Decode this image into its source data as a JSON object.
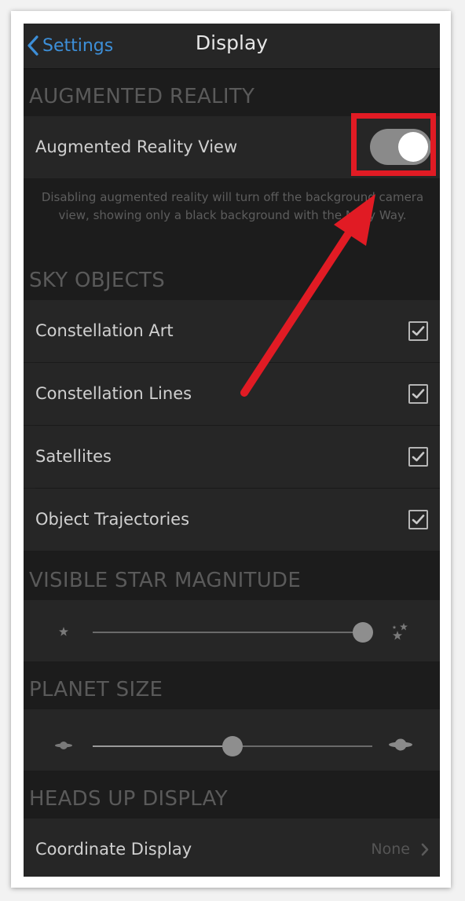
{
  "nav": {
    "back_label": "Settings",
    "title": "Display"
  },
  "sections": {
    "augmented": "AUGMENTED REALITY",
    "sky_objects": "SKY OBJECTS",
    "star_magnitude": "VISIBLE STAR MAGNITUDE",
    "planet_size": "PLANET SIZE",
    "hud": "HEADS UP DISPLAY"
  },
  "ar_view": {
    "label": "Augmented Reality View",
    "enabled": true,
    "help": "Disabling augmented reality will turn off the background camera view, showing only a black background with the Milky Way."
  },
  "sky_items": [
    {
      "label": "Constellation Art",
      "checked": true
    },
    {
      "label": "Constellation Lines",
      "checked": true
    },
    {
      "label": "Satellites",
      "checked": true
    },
    {
      "label": "Object Trajectories",
      "checked": true
    }
  ],
  "sliders": {
    "star_magnitude": {
      "value": 1.0,
      "min_icon": "small-star-icon",
      "max_icon": "stars-icon"
    },
    "planet_size": {
      "value": 0.5,
      "min_icon": "small-planet-icon",
      "max_icon": "large-planet-icon"
    }
  },
  "coordinate_display": {
    "label": "Coordinate Display",
    "value": "None"
  },
  "colors": {
    "accent": "#3d8fd8",
    "annotation": "#e11b24"
  }
}
